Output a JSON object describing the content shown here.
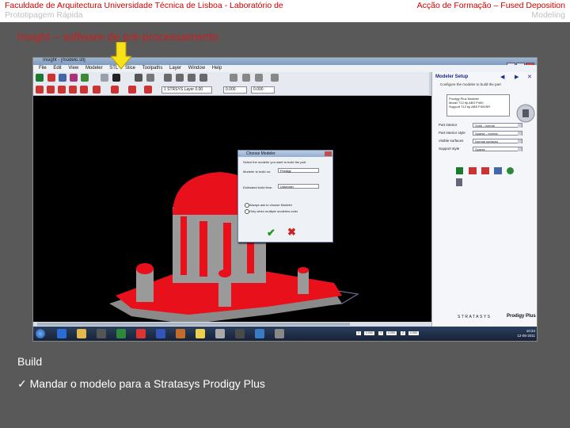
{
  "header": {
    "left_line1": "Faculdade de Arquitectura Universidade Técnica de Lisboa - Laboratório de",
    "left_line2": "Prototipagem Rápida",
    "right_line1": "Acção de Formação – Fused Deposition",
    "right_line2": "Modeling"
  },
  "slide_title": "Insight – software de pré-processamento",
  "app": {
    "window_title": "Insight - [modelo.stl]",
    "menu": [
      "File",
      "Edit",
      "View",
      "Modeler",
      "STL",
      "Slice",
      "Toolpaths",
      "Layer",
      "Window",
      "Help"
    ],
    "toolbar_fields": [
      "1  STRSYS  Layer  0.00",
      "0.000",
      "0.000"
    ],
    "right_panel": {
      "title": "Modeler Setup",
      "subtitle": "Configure the modeler to build the part",
      "info_lines": [
        "Prodigy Plus        Modeler",
        "Model   T12 tip   ABS P400",
        "Support T12 tip   ABS P400SR"
      ],
      "rows": [
        {
          "label": "Part interior",
          "value": "Solid - normal"
        },
        {
          "label": "Part interior style",
          "value": "Sparse - normal"
        },
        {
          "label": "Visible surfaces",
          "value": "Normal surfaces"
        },
        {
          "label": "Support style",
          "value": "Sparse"
        }
      ],
      "brand": "STRATASYS",
      "product": "Prodigy Plus"
    },
    "dialog": {
      "title": "Choose Modeler",
      "prompt": "Select the modeler you want to build the part",
      "modeler_label": "Modeler to build on:",
      "modeler_value": "Prodigy",
      "time_label": "Estimated build time:",
      "time_value": "Unknown",
      "radio1": "Always ask to choose Modeler",
      "radio2": "Only when multiple modelers exist"
    },
    "tray_time": "10:24",
    "tray_date": "12-05-2011",
    "coords": [
      "X",
      "0.000",
      "Y",
      "0.000",
      "Z",
      "0.000"
    ]
  },
  "body": {
    "heading": "Build",
    "bullet": "Mandar o modelo para a Stratasys Prodigy Plus"
  }
}
